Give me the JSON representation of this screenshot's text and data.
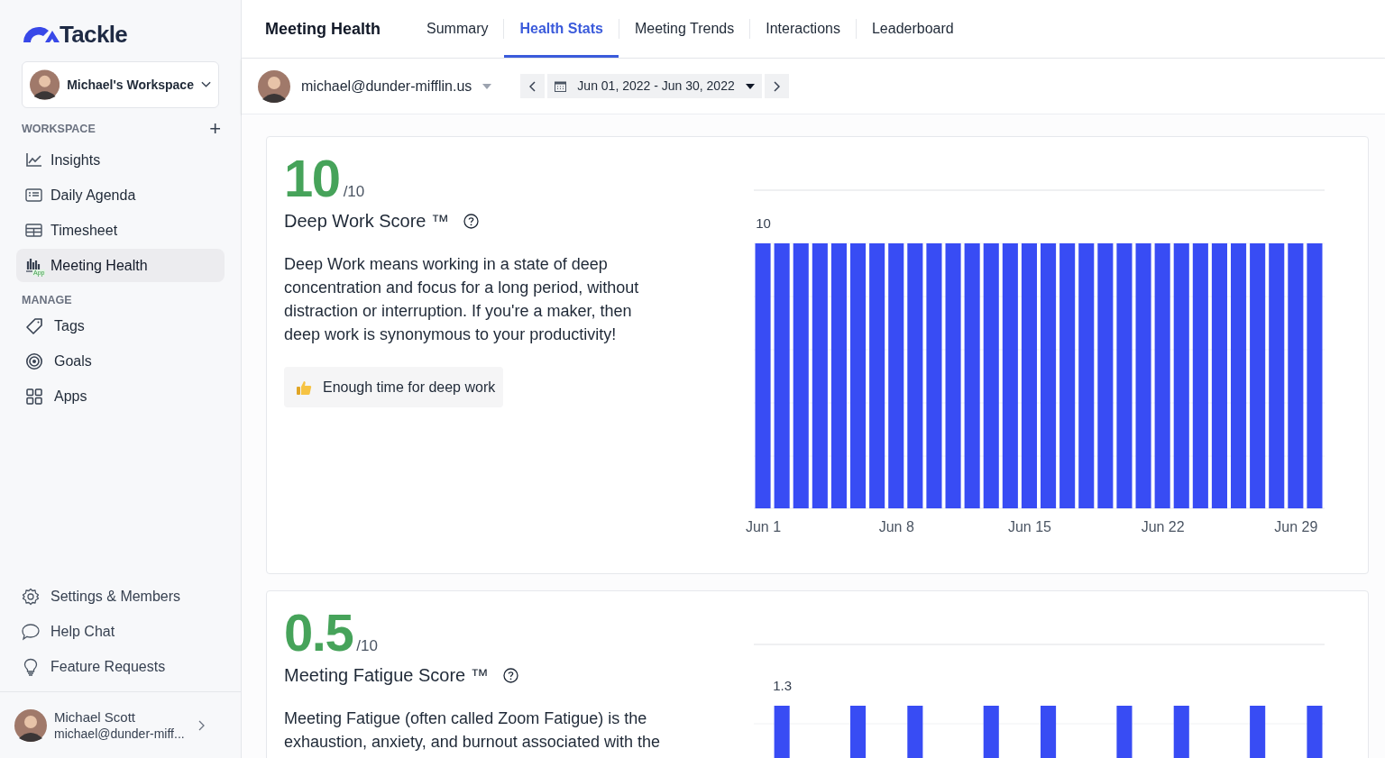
{
  "logo": {
    "text": "Tackle"
  },
  "workspace_switcher": {
    "label": "Michael's Workspace"
  },
  "sidebar": {
    "sections": [
      {
        "title": "WORKSPACE",
        "add_button": "+",
        "items": [
          {
            "label": "Insights",
            "selected": false
          },
          {
            "label": "Daily Agenda",
            "selected": false
          },
          {
            "label": "Timesheet",
            "selected": false
          },
          {
            "label": "Meeting Health",
            "badge": "App",
            "selected": true
          }
        ]
      },
      {
        "title": "MANAGE",
        "items": [
          {
            "label": "Tags",
            "selected": false
          },
          {
            "label": "Goals",
            "selected": false
          },
          {
            "label": "Apps",
            "selected": false
          }
        ]
      }
    ],
    "footer_items": [
      {
        "label": "Settings & Members"
      },
      {
        "label": "Help Chat"
      },
      {
        "label": "Feature Requests"
      }
    ],
    "user": {
      "name": "Michael Scott",
      "email": "michael@dunder-miff..."
    }
  },
  "header": {
    "title": "Meeting Health",
    "tabs": [
      {
        "label": "Summary",
        "selected": false
      },
      {
        "label": "Health Stats",
        "selected": true
      },
      {
        "label": "Meeting Trends",
        "selected": false
      },
      {
        "label": "Interactions",
        "selected": false
      },
      {
        "label": "Leaderboard",
        "selected": false
      }
    ]
  },
  "filters": {
    "user": "michael@dunder-mifflin.us",
    "date_range": "Jun 01, 2022 - Jun 30, 2022"
  },
  "cards": [
    {
      "score": "10",
      "out_of": "/10",
      "title": "Deep Work Score ™",
      "description": "Deep Work means working in a state of deep concentration and focus for a long period, without distraction or interruption. If you're a maker, then deep work is synonymous to your productivity!",
      "status": "Enough time for deep work",
      "chart": {
        "value_label": "10",
        "axis_labels": [
          "Jun 1",
          "Jun 8",
          "Jun 15",
          "Jun 22",
          "Jun 29"
        ]
      }
    },
    {
      "score": "0.5",
      "out_of": "/10",
      "title": "Meeting Fatigue Score ™",
      "description": "Meeting Fatigue (often called Zoom Fatigue) is the exhaustion, anxiety, and burnout associated with the",
      "chart": {
        "value_label": "1.3"
      }
    }
  ]
}
